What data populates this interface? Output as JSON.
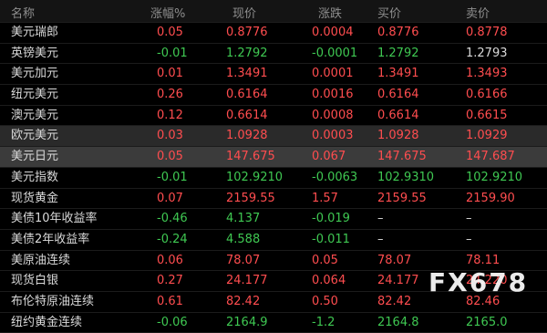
{
  "headers": {
    "name": "名称",
    "change_pct": "涨幅%",
    "price": "现价",
    "change": "涨跌",
    "bid": "买价",
    "ask": "卖价"
  },
  "rows": [
    {
      "name": "美元瑞郎",
      "pct": "0.05",
      "price": "0.8776",
      "chg": "0.0004",
      "bid": "0.8776",
      "ask": "0.8778",
      "trend": "up",
      "ask_color": "red"
    },
    {
      "name": "英镑美元",
      "pct": "-0.01",
      "price": "1.2792",
      "chg": "-0.0001",
      "bid": "1.2792",
      "ask": "1.2793",
      "trend": "down",
      "ask_color": "white"
    },
    {
      "name": "美元加元",
      "pct": "0.01",
      "price": "1.3491",
      "chg": "0.0001",
      "bid": "1.3491",
      "ask": "1.3493",
      "trend": "up",
      "ask_color": "red"
    },
    {
      "name": "纽元美元",
      "pct": "0.26",
      "price": "0.6164",
      "chg": "0.0016",
      "bid": "0.6164",
      "ask": "0.6166",
      "trend": "up",
      "ask_color": "red"
    },
    {
      "name": "澳元美元",
      "pct": "0.12",
      "price": "0.6614",
      "chg": "0.0008",
      "bid": "0.6614",
      "ask": "0.6615",
      "trend": "up",
      "ask_color": "red"
    },
    {
      "name": "欧元美元",
      "pct": "0.03",
      "price": "1.0928",
      "chg": "0.0003",
      "bid": "1.0928",
      "ask": "1.0929",
      "trend": "up",
      "ask_color": "red",
      "style": "alt"
    },
    {
      "name": "美元日元",
      "pct": "0.05",
      "price": "147.675",
      "chg": "0.067",
      "bid": "147.675",
      "ask": "147.687",
      "trend": "up",
      "ask_color": "red",
      "style": "sel"
    },
    {
      "name": "美元指数",
      "pct": "-0.01",
      "price": "102.9210",
      "chg": "-0.0063",
      "bid": "102.9310",
      "ask": "102.9210",
      "trend": "down",
      "ask_color": "green"
    },
    {
      "name": "现货黄金",
      "pct": "0.07",
      "price": "2159.55",
      "chg": "1.57",
      "bid": "2159.55",
      "ask": "2159.90",
      "trend": "up",
      "ask_color": "red"
    },
    {
      "name": "美债10年收益率",
      "pct": "-0.46",
      "price": "4.137",
      "chg": "-0.019",
      "bid": "–",
      "ask": "–",
      "trend": "down",
      "ask_color": "white"
    },
    {
      "name": "美债2年收益率",
      "pct": "-0.24",
      "price": "4.588",
      "chg": "-0.011",
      "bid": "–",
      "ask": "–",
      "trend": "down",
      "ask_color": "white"
    },
    {
      "name": "美原油连续",
      "pct": "0.06",
      "price": "78.07",
      "chg": "0.05",
      "bid": "78.07",
      "ask": "78.11",
      "trend": "up",
      "ask_color": "red"
    },
    {
      "name": "现货白银",
      "pct": "0.27",
      "price": "24.177",
      "chg": "0.064",
      "bid": "24.177",
      "ask": "24.220",
      "trend": "up",
      "ask_color": "red"
    },
    {
      "name": "布伦特原油连续",
      "pct": "0.61",
      "price": "82.42",
      "chg": "0.50",
      "bid": "82.42",
      "ask": "82.46",
      "trend": "up",
      "ask_color": "red"
    },
    {
      "name": "纽约黄金连续",
      "pct": "-0.06",
      "price": "2164.9",
      "chg": "-1.2",
      "bid": "2164.8",
      "ask": "2165.0",
      "trend": "down",
      "ask_color": "green"
    }
  ],
  "watermark": "FX678"
}
